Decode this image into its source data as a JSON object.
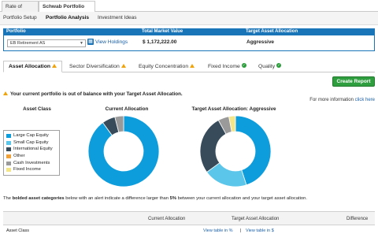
{
  "top_tabs": {
    "rate_of_return": "Rate of Return",
    "portfolio_checkup": "Schwab Portfolio Checkup"
  },
  "sub_nav": {
    "setup": "Portfolio Setup",
    "analysis": "Portfolio Analysis",
    "ideas": "Investment Ideas"
  },
  "portfolio": {
    "col_portfolio": "Portfolio",
    "col_market_value": "Total Market Value",
    "col_target": "Target Asset Allocation",
    "selected": "EB Retirement AS",
    "view_holdings": "View Holdings",
    "market_value": "$ 1,172,222.00",
    "target": "Aggressive"
  },
  "analysis_tabs": [
    {
      "label": "Asset Allocation",
      "status": "warning"
    },
    {
      "label": "Sector Diversification",
      "status": "warning"
    },
    {
      "label": "Equity Concentration",
      "status": "warning"
    },
    {
      "label": "Fixed Income",
      "status": "ok"
    },
    {
      "label": "Quality",
      "status": "ok"
    }
  ],
  "create_report": "Create Report",
  "balance_message": "Your current portfolio is out of balance with your Target Asset Allocation.",
  "more_info": {
    "text": "For more information",
    "link": "click here"
  },
  "columns": {
    "asset_class": "Asset Class",
    "current": "Current Allocation",
    "target": "Target Asset Allocation: Aggressive"
  },
  "legend": [
    {
      "label": "Large Cap Equity",
      "color": "#0e9ddc"
    },
    {
      "label": "Small Cap Equity",
      "color": "#5cc6ea"
    },
    {
      "label": "International Equity",
      "color": "#384b5a"
    },
    {
      "label": "Other",
      "color": "#f1a13a"
    },
    {
      "label": "Cash Investments",
      "color": "#9a9a9a"
    },
    {
      "label": "Fixed Income",
      "color": "#f3e58a"
    }
  ],
  "chart_data": [
    {
      "type": "pie",
      "title": "Current Allocation",
      "categories": [
        "Large Cap Equity",
        "Small Cap Equity",
        "International Equity",
        "Other",
        "Cash Investments",
        "Fixed Income"
      ],
      "values": [
        90,
        0,
        6,
        0,
        4,
        0
      ]
    },
    {
      "type": "pie",
      "title": "Target Asset Allocation: Aggressive",
      "categories": [
        "Large Cap Equity",
        "Small Cap Equity",
        "International Equity",
        "Other",
        "Cash Investments",
        "Fixed Income"
      ],
      "values": [
        45,
        20,
        27,
        0,
        5,
        3
      ]
    }
  ],
  "bold_note": {
    "pre": "The ",
    "bold1": "bolded asset categories",
    "mid": " below with an alert indicate a difference larger than ",
    "bold2": "5%",
    "post": " between your current allocation and your target asset allocation."
  },
  "table": {
    "col_current": "Current Allocation",
    "col_target": "Target Asset Allocation",
    "col_diff": "Difference",
    "row_label": "Asset Class",
    "view_percent": "View table in %",
    "separator": " | ",
    "view_dollar": "View table in $"
  }
}
